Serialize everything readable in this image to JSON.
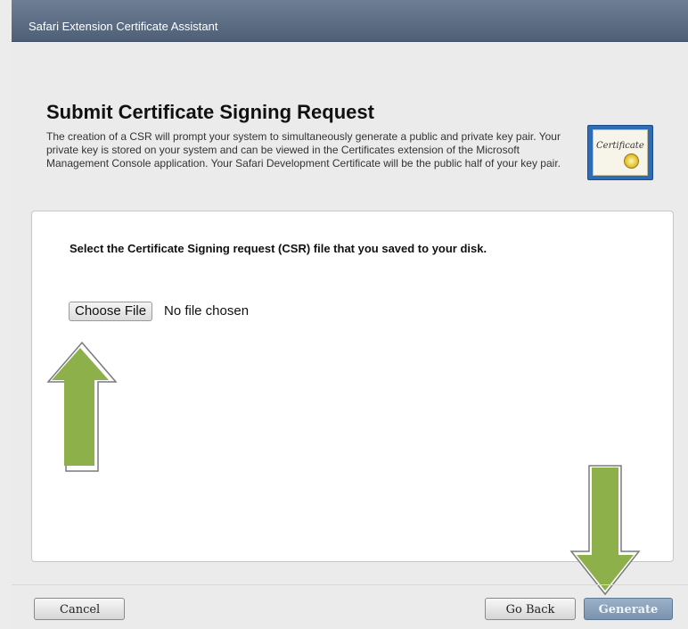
{
  "window": {
    "title": "Safari Extension Certificate Assistant"
  },
  "header": {
    "heading": "Submit Certificate Signing Request",
    "description": "The creation of a CSR will prompt your system to simultaneously generate a public and private key pair. Your private key is stored on your system and can be viewed in the Certificates extension of the Microsoft Management Console application. Your Safari Development Certificate will be the public half of your key pair.",
    "icon": "certificate-icon",
    "icon_text": "Certificate"
  },
  "panel": {
    "instruction": "Select the Certificate Signing request (CSR) file that you saved to your disk.",
    "choose_file_label": "Choose File",
    "file_status": "No file chosen"
  },
  "annotations": {
    "arrow_color": "#8db04a",
    "up_arrow": "up-arrow-icon",
    "down_arrow": "down-arrow-icon"
  },
  "footer": {
    "cancel_label": "Cancel",
    "go_back_label": "Go Back",
    "generate_label": "Generate"
  }
}
